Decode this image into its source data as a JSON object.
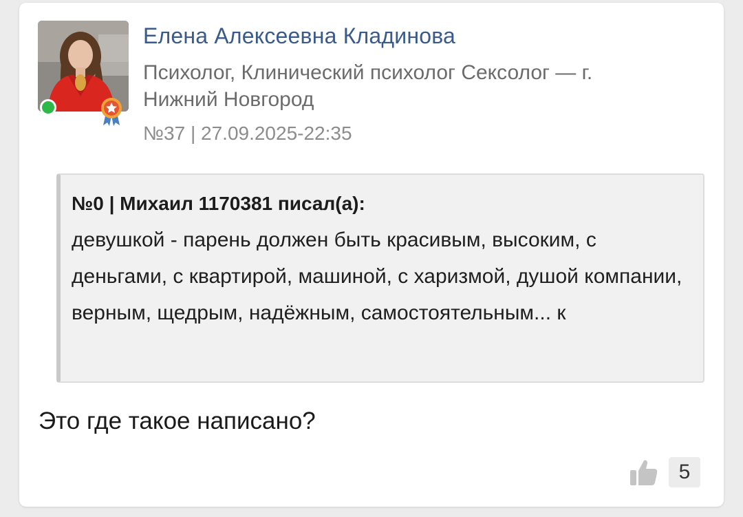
{
  "colors": {
    "author_name": "#3a5a8c",
    "online": "#2fb84a",
    "quote_bg": "#f1f1f1"
  },
  "author": {
    "name": "Елена Алексеевна Кладинова",
    "role": "Психолог, Клинический психолог Сексолог — г. Нижний Новгород",
    "avatar_icon": "user-photo",
    "status_icon": "online-dot",
    "badge_icon": "award-medal-icon"
  },
  "post": {
    "meta": "№37 | 27.09.2025-22:35",
    "quote": {
      "header": "№0 | Михаил 1170381 писал(а):",
      "body": "девушкой - парень должен быть красивым, высоким, с деньгами, с квартирой, машиной, с харизмой, душой компании, верным, щедрым, надёжным, самостоятельным... к"
    },
    "text": "Это где такое написано?",
    "likes": {
      "icon": "thumbs-up-icon",
      "count": "5"
    }
  }
}
